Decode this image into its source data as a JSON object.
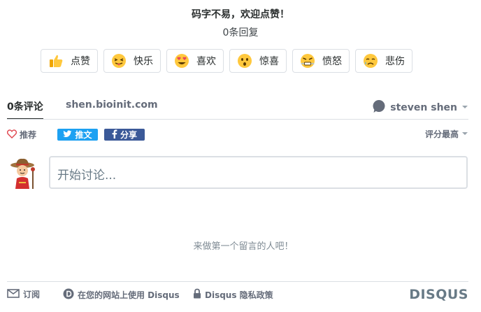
{
  "header": {
    "headline": "码字不易，欢迎点赞！",
    "reply_count": "0条回复"
  },
  "reactions": [
    {
      "label": "点赞",
      "icon": "thumbs-up-icon"
    },
    {
      "label": "快乐",
      "icon": "tongue-out-face-icon"
    },
    {
      "label": "喜欢",
      "icon": "heart-eyes-face-icon"
    },
    {
      "label": "惊喜",
      "icon": "surprised-face-icon"
    },
    {
      "label": "愤怒",
      "icon": "angry-face-icon"
    },
    {
      "label": "悲伤",
      "icon": "sad-face-icon"
    }
  ],
  "tabs": {
    "comments": "0条评论",
    "site": "shen.bioinit.com",
    "user": "steven shen"
  },
  "actions": {
    "recommend": "推荐",
    "tweet": "推文",
    "share": "分享",
    "sort": "评分最高"
  },
  "composer": {
    "placeholder": "开始讨论..."
  },
  "empty_message": "来做第一个留言的人吧！",
  "footer": {
    "subscribe": "订阅",
    "add_disqus": "在您的网站上使用 Disqus",
    "privacy": "Disqus 隐私政策",
    "logo": "DISQUS"
  },
  "colors": {
    "twitter": "#1da1f2",
    "facebook": "#3b5998",
    "recommend_heart": "#e0444d",
    "text_muted": "#656c7a"
  }
}
